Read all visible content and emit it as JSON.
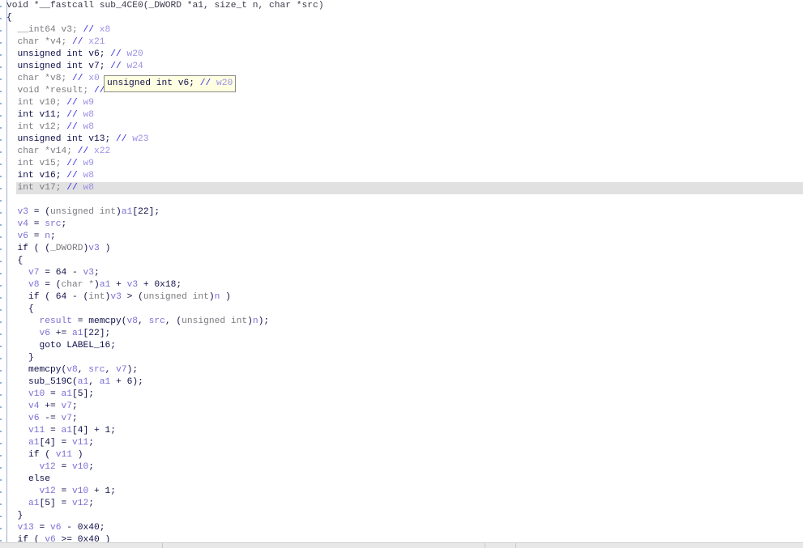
{
  "view": "pseudocode",
  "highlighted_line": 15,
  "colors": {
    "keyword": "#10104a",
    "gray": "#7a7a80",
    "variable": "#7b6fd6",
    "comment": "#3a2fe0",
    "register": "#9a90e6",
    "highlight": "#e1e1e1",
    "tooltip_bg": "#ffffe1"
  },
  "tooltip": {
    "decl": "unsigned int v6; ",
    "comment": "// ",
    "reg": "w20"
  },
  "code": {
    "lines": [
      [
        [
          "h",
          "void *__fastcall sub_4CE0(_DWORD *a1, size_t n, char *src)"
        ]
      ],
      [
        [
          "k",
          "{"
        ]
      ],
      [
        [
          "g",
          "  __int64 v3; "
        ],
        [
          "c",
          "// "
        ],
        [
          "r",
          "x8"
        ]
      ],
      [
        [
          "g",
          "  char *v4; "
        ],
        [
          "c",
          "// "
        ],
        [
          "r",
          "x21"
        ]
      ],
      [
        [
          "k",
          "  unsigned int v6; "
        ],
        [
          "c",
          "// "
        ],
        [
          "r",
          "w20"
        ]
      ],
      [
        [
          "k",
          "  unsigned int v7; "
        ],
        [
          "c",
          "// "
        ],
        [
          "r",
          "w24"
        ]
      ],
      [
        [
          "g",
          "  char *v8; "
        ],
        [
          "c",
          "// "
        ],
        [
          "r",
          "x0"
        ]
      ],
      [
        [
          "g",
          "  void *result; "
        ],
        [
          "c",
          "// "
        ],
        [
          "r",
          "x0"
        ]
      ],
      [
        [
          "g",
          "  int v10; "
        ],
        [
          "c",
          "// "
        ],
        [
          "r",
          "w9"
        ]
      ],
      [
        [
          "k",
          "  int v11; "
        ],
        [
          "c",
          "// "
        ],
        [
          "r",
          "w8"
        ]
      ],
      [
        [
          "g",
          "  int v12; "
        ],
        [
          "c",
          "// "
        ],
        [
          "r",
          "w8"
        ]
      ],
      [
        [
          "k",
          "  unsigned int v13; "
        ],
        [
          "c",
          "// "
        ],
        [
          "r",
          "w23"
        ]
      ],
      [
        [
          "g",
          "  char *v14; "
        ],
        [
          "c",
          "// "
        ],
        [
          "r",
          "x22"
        ]
      ],
      [
        [
          "g",
          "  int v15; "
        ],
        [
          "c",
          "// "
        ],
        [
          "r",
          "w9"
        ]
      ],
      [
        [
          "k",
          "  int v16; "
        ],
        [
          "c",
          "// "
        ],
        [
          "r",
          "w8"
        ]
      ],
      [
        [
          "g",
          "  int v17; "
        ],
        [
          "c",
          "// "
        ],
        [
          "r",
          "w8"
        ]
      ],
      [],
      [
        [
          "v",
          "  v3"
        ],
        [
          "k",
          " = ("
        ],
        [
          "g",
          "unsigned int"
        ],
        [
          "k",
          ")"
        ],
        [
          "v",
          "a1"
        ],
        [
          "k",
          "[22];"
        ]
      ],
      [
        [
          "v",
          "  v4"
        ],
        [
          "k",
          " = "
        ],
        [
          "v",
          "src"
        ],
        [
          "k",
          ";"
        ]
      ],
      [
        [
          "v",
          "  v6"
        ],
        [
          "k",
          " = "
        ],
        [
          "v",
          "n"
        ],
        [
          "k",
          ";"
        ]
      ],
      [
        [
          "k",
          "  if ( ("
        ],
        [
          "g",
          "_DWORD"
        ],
        [
          "k",
          ")"
        ],
        [
          "v",
          "v3"
        ],
        [
          "k",
          " )"
        ]
      ],
      [
        [
          "k",
          "  {"
        ]
      ],
      [
        [
          "v",
          "    v7"
        ],
        [
          "k",
          " = 64 - "
        ],
        [
          "v",
          "v3"
        ],
        [
          "k",
          ";"
        ]
      ],
      [
        [
          "v",
          "    v8"
        ],
        [
          "k",
          " = ("
        ],
        [
          "g",
          "char *"
        ],
        [
          "k",
          ")"
        ],
        [
          "v",
          "a1"
        ],
        [
          "k",
          " + "
        ],
        [
          "v",
          "v3"
        ],
        [
          "k",
          " + 0x18;"
        ]
      ],
      [
        [
          "k",
          "    if ( 64 - ("
        ],
        [
          "g",
          "int"
        ],
        [
          "k",
          ")"
        ],
        [
          "v",
          "v3"
        ],
        [
          "k",
          " > ("
        ],
        [
          "g",
          "unsigned int"
        ],
        [
          "k",
          ")"
        ],
        [
          "v",
          "n"
        ],
        [
          "k",
          " )"
        ]
      ],
      [
        [
          "k",
          "    {"
        ]
      ],
      [
        [
          "v",
          "      result"
        ],
        [
          "k",
          " = memcpy("
        ],
        [
          "v",
          "v8"
        ],
        [
          "k",
          ", "
        ],
        [
          "v",
          "src"
        ],
        [
          "k",
          ", ("
        ],
        [
          "g",
          "unsigned int"
        ],
        [
          "k",
          ")"
        ],
        [
          "v",
          "n"
        ],
        [
          "k",
          ");"
        ]
      ],
      [
        [
          "v",
          "      v6"
        ],
        [
          "k",
          " += "
        ],
        [
          "v",
          "a1"
        ],
        [
          "k",
          "[22];"
        ]
      ],
      [
        [
          "k",
          "      goto LABEL_16;"
        ]
      ],
      [
        [
          "k",
          "    }"
        ]
      ],
      [
        [
          "k",
          "    memcpy("
        ],
        [
          "v",
          "v8"
        ],
        [
          "k",
          ", "
        ],
        [
          "v",
          "src"
        ],
        [
          "k",
          ", "
        ],
        [
          "v",
          "v7"
        ],
        [
          "k",
          ");"
        ]
      ],
      [
        [
          "k",
          "    sub_519C("
        ],
        [
          "v",
          "a1"
        ],
        [
          "k",
          ", "
        ],
        [
          "v",
          "a1"
        ],
        [
          "k",
          " + 6);"
        ]
      ],
      [
        [
          "v",
          "    v10"
        ],
        [
          "k",
          " = "
        ],
        [
          "v",
          "a1"
        ],
        [
          "k",
          "[5];"
        ]
      ],
      [
        [
          "v",
          "    v4"
        ],
        [
          "k",
          " += "
        ],
        [
          "v",
          "v7"
        ],
        [
          "k",
          ";"
        ]
      ],
      [
        [
          "v",
          "    v6"
        ],
        [
          "k",
          " -= "
        ],
        [
          "v",
          "v7"
        ],
        [
          "k",
          ";"
        ]
      ],
      [
        [
          "v",
          "    v11"
        ],
        [
          "k",
          " = "
        ],
        [
          "v",
          "a1"
        ],
        [
          "k",
          "[4] + 1;"
        ]
      ],
      [
        [
          "v",
          "    a1"
        ],
        [
          "k",
          "[4] = "
        ],
        [
          "v",
          "v11"
        ],
        [
          "k",
          ";"
        ]
      ],
      [
        [
          "k",
          "    if ( "
        ],
        [
          "v",
          "v11"
        ],
        [
          "k",
          " )"
        ]
      ],
      [
        [
          "v",
          "      v12"
        ],
        [
          "k",
          " = "
        ],
        [
          "v",
          "v10"
        ],
        [
          "k",
          ";"
        ]
      ],
      [
        [
          "k",
          "    else"
        ]
      ],
      [
        [
          "v",
          "      v12"
        ],
        [
          "k",
          " = "
        ],
        [
          "v",
          "v10"
        ],
        [
          "k",
          " + 1;"
        ]
      ],
      [
        [
          "v",
          "    a1"
        ],
        [
          "k",
          "[5] = "
        ],
        [
          "v",
          "v12"
        ],
        [
          "k",
          ";"
        ]
      ],
      [
        [
          "k",
          "  }"
        ]
      ],
      [
        [
          "v",
          "  v13"
        ],
        [
          "k",
          " = "
        ],
        [
          "v",
          "v6"
        ],
        [
          "k",
          " - 0x40;"
        ]
      ],
      [
        [
          "k",
          "  if ( "
        ],
        [
          "v",
          "v6"
        ],
        [
          "k",
          " >= 0x40 )"
        ]
      ]
    ]
  }
}
